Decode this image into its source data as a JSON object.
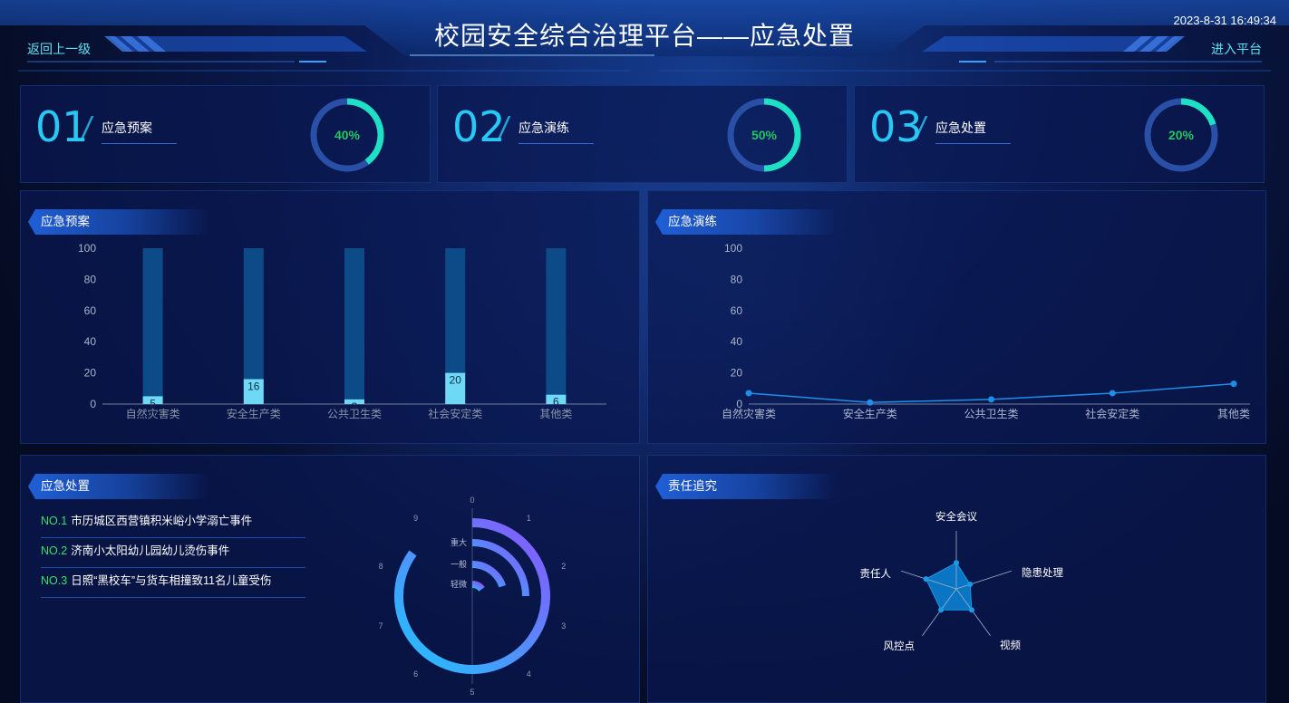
{
  "header": {
    "title": "校园安全综合治理平台——应急处置",
    "datetime": "2023-8-31 16:49:34",
    "back_label": "返回上一级",
    "enter_label": "进入平台"
  },
  "kpis": [
    {
      "num": "01",
      "label": "应急预案",
      "percent": "40%",
      "value": 40,
      "color": "#1ee0c4"
    },
    {
      "num": "02",
      "label": "应急演练",
      "percent": "50%",
      "value": 50,
      "color": "#1ee0c4"
    },
    {
      "num": "03",
      "label": "应急处置",
      "percent": "20%",
      "value": 20,
      "color": "#1ee0c4"
    }
  ],
  "panels": {
    "plan": "应急预案",
    "drill": "应急演练",
    "handle": "应急处置",
    "duty": "责任追究"
  },
  "incidents": [
    {
      "no": "NO.1",
      "text": "市历城区西营镇积米峪小学溺亡事件"
    },
    {
      "no": "NO.2",
      "text": "济南小太阳幼儿园幼儿烫伤事件"
    },
    {
      "no": "NO.3",
      "text": "日照“黑校车”与货车相撞致11名儿童受伤"
    }
  ],
  "chart_data": [
    {
      "type": "bar",
      "categories": [
        "自然灾害类",
        "安全生产类",
        "公共卫生类",
        "社会安定类",
        "其他类"
      ],
      "values": [
        5,
        16,
        3,
        20,
        6
      ],
      "ylim": [
        0,
        100
      ],
      "yticks": [
        0,
        20,
        40,
        60,
        80,
        100
      ],
      "colors": {
        "bar": "#6fd9f5",
        "track": "#0c4a88"
      }
    },
    {
      "type": "line",
      "categories": [
        "自然灾害类",
        "安全生产类",
        "公共卫生类",
        "社会安定类",
        "其他类"
      ],
      "values": [
        7,
        1,
        3,
        7,
        13
      ],
      "ylim": [
        0,
        100
      ],
      "yticks": [
        0,
        20,
        40,
        60,
        80,
        100
      ],
      "colors": {
        "line": "#1e8fe6"
      }
    },
    {
      "type": "polar-bar",
      "angle_ticks": [
        "0",
        "1",
        "2",
        "3",
        "4",
        "5",
        "6",
        "7",
        "8",
        "9"
      ],
      "categories": [
        "重大",
        "一般",
        "轻微"
      ],
      "values": [
        2.5,
        2,
        1.5
      ],
      "outer_value": 8.5,
      "outer_max": 10,
      "colors": {
        "grad_start": "#20c4ff",
        "grad_end": "#8a55ff"
      }
    },
    {
      "type": "radar",
      "indicators": [
        "安全会议",
        "隐患处理",
        "视频",
        "风控点",
        "责任人"
      ],
      "values": [
        0.45,
        0.25,
        0.45,
        0.45,
        0.55
      ],
      "colors": {
        "fill": "#0a86d8",
        "stroke": "#1a9ae8"
      }
    }
  ]
}
